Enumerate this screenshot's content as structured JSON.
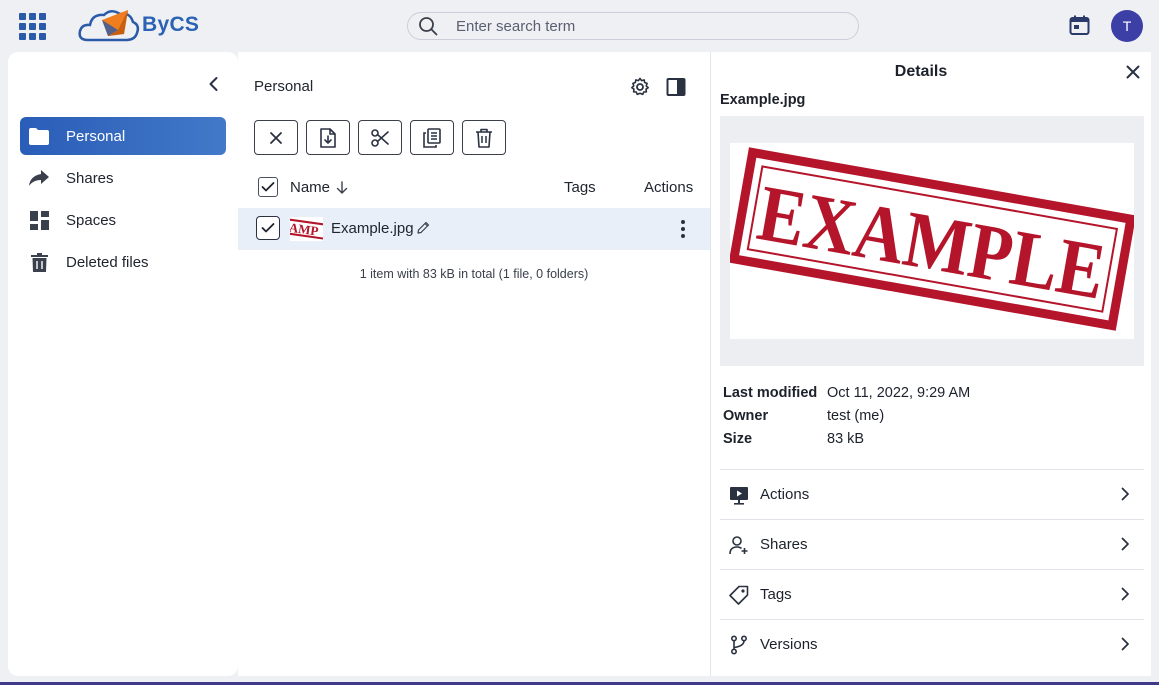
{
  "header": {
    "brand": "ByCS",
    "search_placeholder": "Enter search term",
    "avatar_initial": "T",
    "accent_color": "#2a63b3"
  },
  "sidebar": {
    "items": [
      {
        "label": "Personal",
        "icon": "folder-icon",
        "active": true
      },
      {
        "label": "Shares",
        "icon": "share-arrow-icon",
        "active": false
      },
      {
        "label": "Spaces",
        "icon": "grid-icon",
        "active": false
      },
      {
        "label": "Deleted files",
        "icon": "trash-icon",
        "active": false
      }
    ]
  },
  "main": {
    "breadcrumb": "Personal",
    "toolbar": [
      "clear-selection",
      "download",
      "cut",
      "copy",
      "delete"
    ],
    "columns": {
      "name": "Name",
      "tags": "Tags",
      "actions": "Actions"
    },
    "rows": [
      {
        "name": "Example.jpg",
        "selected": true
      }
    ],
    "summary": "1 item with 83 kB in total (1 file, 0 folders)"
  },
  "details": {
    "title": "Details",
    "file_name": "Example.jpg",
    "preview_text": "EXAMPLE",
    "meta": {
      "last_modified_label": "Last modified",
      "last_modified_value": "Oct 11, 2022, 9:29 AM",
      "owner_label": "Owner",
      "owner_value": "test (me)",
      "size_label": "Size",
      "size_value": "83 kB"
    },
    "panels": [
      "Actions",
      "Shares",
      "Tags",
      "Versions"
    ]
  }
}
